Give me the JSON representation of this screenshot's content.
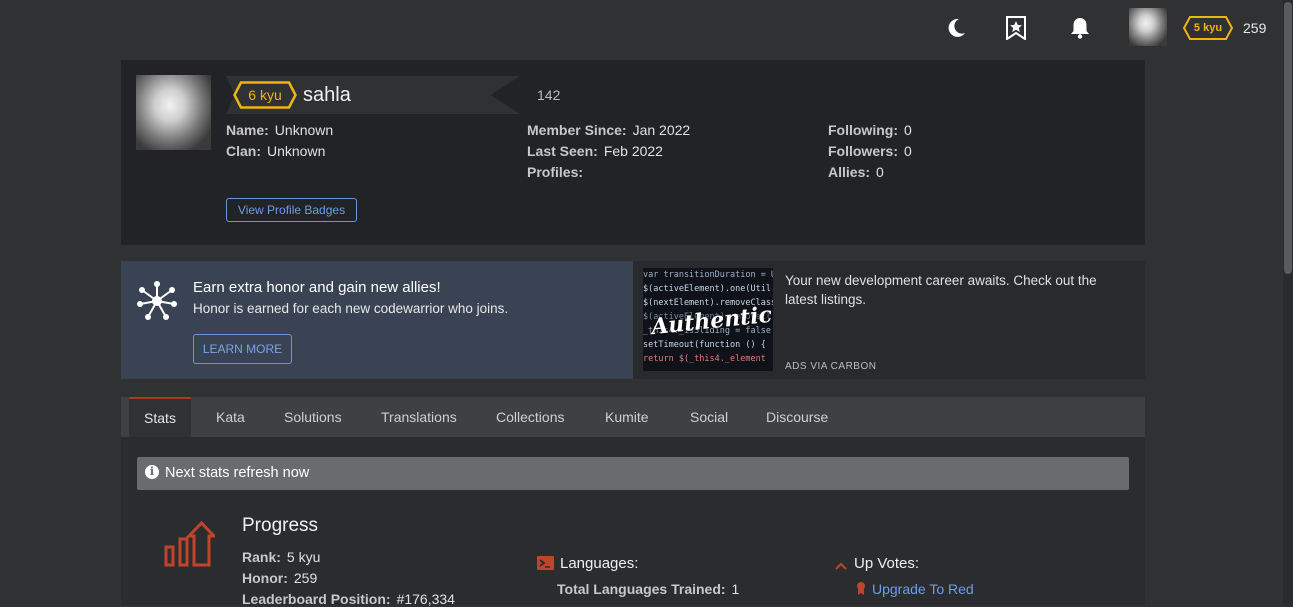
{
  "topbar": {
    "rank": "5 kyu",
    "honor": "259",
    "icons": [
      "moon-icon",
      "bookmark-star-icon",
      "bell-icon"
    ]
  },
  "profile": {
    "rank": "6 kyu",
    "username": "sahla",
    "honor": "142",
    "name_label": "Name:",
    "name_value": "Unknown",
    "clan_label": "Clan:",
    "clan_value": "Unknown",
    "member_since_label": "Member Since:",
    "member_since_value": "Jan 2022",
    "last_seen_label": "Last Seen:",
    "last_seen_value": "Feb 2022",
    "profiles_label": "Profiles:",
    "following_label": "Following:",
    "following_value": "0",
    "followers_label": "Followers:",
    "followers_value": "0",
    "allies_label": "Allies:",
    "allies_value": "0",
    "badges_button": "View Profile Badges"
  },
  "promo": {
    "title": "Earn extra honor and gain new allies!",
    "subtitle": "Honor is earned for each new codewarrior who joins.",
    "button": "LEARN MORE"
  },
  "ad": {
    "text": "Your new development career awaits. Check out the latest listings.",
    "via": "ADS VIA CARBON",
    "logo_text": "Authentic",
    "code_lines": [
      "var transitionDuration = Util",
      "$(activeElement).one(Util.TR",
      "  $(nextElement).removeClass",
      "  $(activeElement).removeCl",
      "  _this4._isSliding = false",
      "  setTimeout(function () {",
      "    return $(_this4._element"
    ]
  },
  "tabs": [
    "Stats",
    "Kata",
    "Solutions",
    "Translations",
    "Collections",
    "Kumite",
    "Social",
    "Discourse"
  ],
  "notice": "Next stats refresh now",
  "progress": {
    "title": "Progress",
    "rank_label": "Rank:",
    "rank_value": "5 kyu",
    "honor_label": "Honor:",
    "honor_value": "259",
    "leaderboard_label": "Leaderboard Position:",
    "leaderboard_value": "#176,334"
  },
  "languages": {
    "title": "Languages:",
    "trained_label": "Total Languages Trained:",
    "trained_value": "1"
  },
  "upvotes": {
    "title": "Up Votes:",
    "upgrade_link": "Upgrade To Red"
  },
  "colors": {
    "rank_yellow": "#ecb613",
    "link_blue": "#6e9de8",
    "accent_red": "#b1361e"
  }
}
